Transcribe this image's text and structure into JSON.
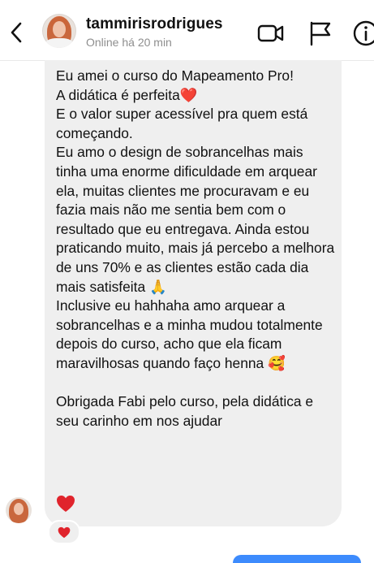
{
  "header": {
    "username": "tammirisrodrigues",
    "status": "Online há 20 min",
    "icons": [
      "back-chevron-icon",
      "video-call-icon",
      "flag-icon",
      "info-icon"
    ]
  },
  "message": {
    "text": "Eu amei o curso do Mapeamento Pro!\nA didática é perfeita❤️\nE o valor super acessível pra quem está começando.\nEu amo o design de sobrancelhas mais tinha uma enorme dificuldade em arquear ela, muitas clientes me procuravam e eu fazia mais não me sentia bem com o resultado que eu entregava. Ainda estou praticando muito, mais já percebo a melhora de uns 70% e as clientes estão cada dia mais satisfeita 🙏\nInclusive eu hahhaha amo arquear a sobrancelhas e a minha mudou totalmente depois do curso, acho que ela ficam maravilhosas quando faço henna 🥰\n\nObrigada Fabi pelo curso, pela didática e seu carinho em nos ajudar",
    "trailing_emoji": "red-heart",
    "reaction": "red-heart",
    "bubble_color": "#efefef"
  },
  "colors": {
    "heart": "#e0242c",
    "muted_text": "#8e8e8e",
    "accent_blue": "#3d8bfd"
  }
}
